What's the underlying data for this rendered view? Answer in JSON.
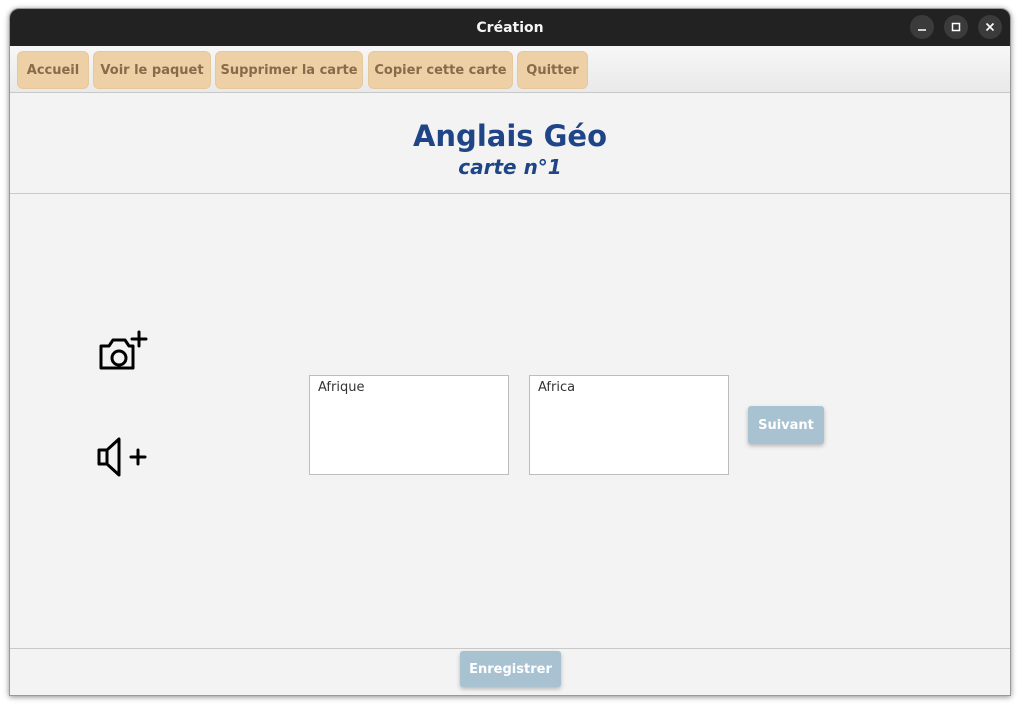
{
  "window": {
    "title": "Création"
  },
  "menu": {
    "items": [
      {
        "label": "Accueil"
      },
      {
        "label": "Voir le paquet"
      },
      {
        "label": "Supprimer la carte"
      },
      {
        "label": "Copier cette carte"
      },
      {
        "label": "Quitter"
      }
    ]
  },
  "header": {
    "title": "Anglais Géo",
    "subtitle": "carte n°1"
  },
  "card": {
    "front": "Afrique",
    "back": "Africa",
    "next_label": "Suivant"
  },
  "footer": {
    "save_label": "Enregistrer"
  },
  "icons": {
    "add_image": "camera-plus-icon",
    "add_sound": "speaker-plus-icon"
  },
  "colors": {
    "menu_button": "#edd0a6",
    "menu_text": "#8a6a4a",
    "title": "#1f4587",
    "action_button": "#a8c2d1"
  }
}
